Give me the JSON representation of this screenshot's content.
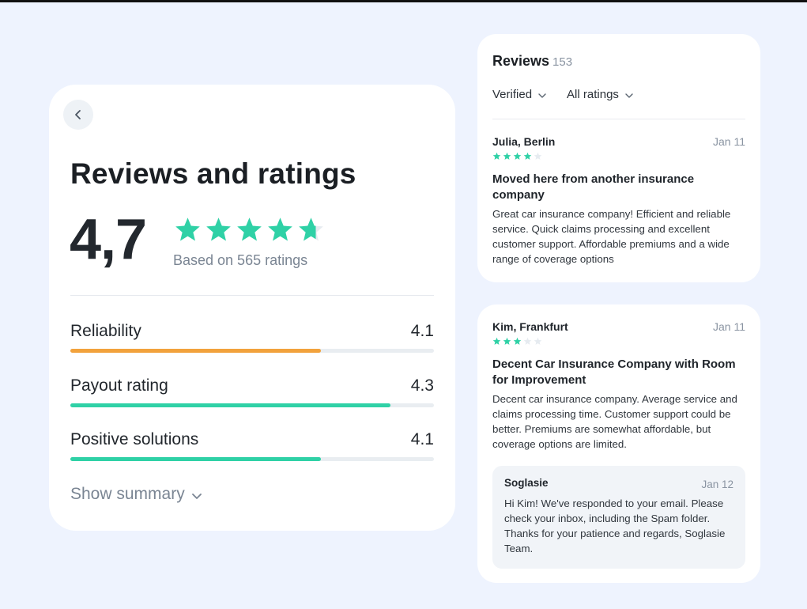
{
  "colors": {
    "accent": "#2fd1a6",
    "warning": "#f2a23c",
    "star_empty": "#e6ebf0"
  },
  "ratings": {
    "title": "Reviews and ratings",
    "score": "4,7",
    "stars_value": 4.7,
    "based_on": "Based on 565 ratings",
    "metrics": [
      {
        "label": "Reliability",
        "value": "4.1",
        "fill": 0.69,
        "color": "#f2a23c"
      },
      {
        "label": "Payout rating",
        "value": "4.3",
        "fill": 0.88,
        "color": "#2fd1a6"
      },
      {
        "label": "Positive solutions",
        "value": "4.1",
        "fill": 0.69,
        "color": "#2fd1a6"
      }
    ],
    "show_summary": "Show summary"
  },
  "reviews": {
    "title": "Reviews",
    "count": "153",
    "filters": [
      "Verified",
      "All ratings"
    ],
    "items": [
      {
        "author": "Julia, Berlin",
        "date": "Jan 11",
        "stars": 4,
        "headline": "Moved here from another insurance company",
        "body": "Great car insurance company! Efficient and reliable service. Quick claims processing and excellent customer support. Affordable premiums and a wide range of coverage options"
      },
      {
        "author": "Kim, Frankfurt",
        "date": "Jan 11",
        "stars": 3,
        "headline": "Decent Car Insurance Company with Room for Improvement",
        "body": "Decent car insurance company. Average service and claims processing time. Customer support could be better. Premiums are somewhat affordable, but coverage options are limited.",
        "reply": {
          "author": "Soglasie",
          "date": "Jan 12",
          "body": "Hi Kim! We've responded to your email. Please check your inbox, including the Spam folder. Thanks for your patience and regards, Soglasie Team."
        }
      }
    ]
  },
  "icons": {
    "back": "chevron-left-icon",
    "dropdown": "chevron-down-icon",
    "star": "star-icon"
  }
}
